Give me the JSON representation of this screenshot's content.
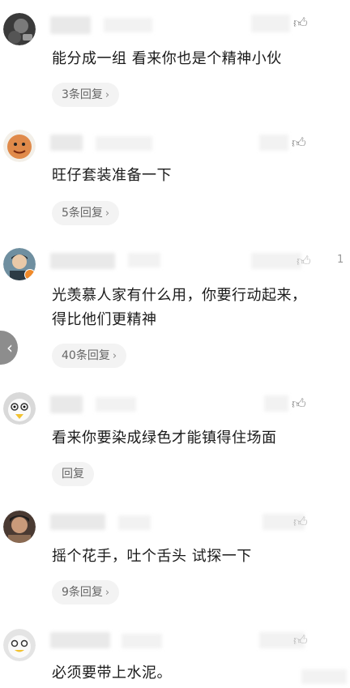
{
  "comments": [
    {
      "text": "能分成一组 看来你也是个精神小伙",
      "reply": "3条回复",
      "reply_chevron": "›"
    },
    {
      "text": "旺仔套装准备一下",
      "reply": "5条回复",
      "reply_chevron": "›"
    },
    {
      "text_lines": [
        "光羡慕人家有什么用，你要行动起来，",
        "得比他们更精神"
      ],
      "reply": "40条回复",
      "reply_chevron": "›",
      "side_number": "1"
    },
    {
      "text": "看来你要染成绿色才能镇得住场面",
      "reply": "回复"
    },
    {
      "text": "摇个花手，吐个舌头 试探一下",
      "reply": "9条回复",
      "reply_chevron": "›"
    },
    {
      "text": "必须要带上水泥。"
    }
  ],
  "icons": {
    "like": "thumbs-up-icon",
    "back": "back-chevron-icon"
  },
  "back_glyph": "‹"
}
